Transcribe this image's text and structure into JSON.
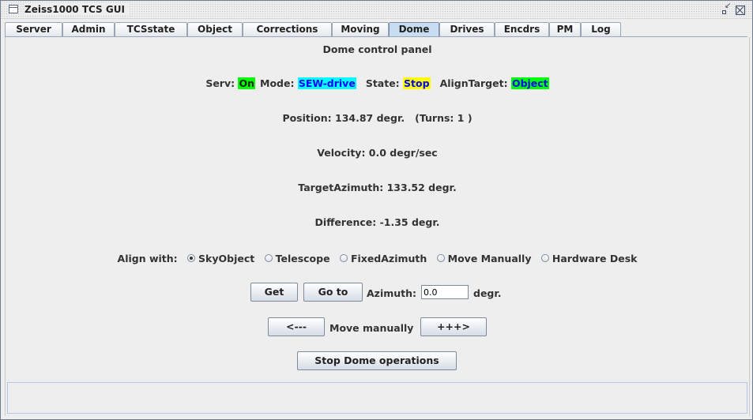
{
  "window": {
    "title": "Zeiss1000 TCS GUI"
  },
  "tabs": [
    "Server",
    "Admin",
    "TCSstate",
    "Object",
    "Corrections",
    "Moving",
    "Dome",
    "Drives",
    "Encdrs",
    "PM",
    "Log"
  ],
  "active_tab": "Dome",
  "panel": {
    "title": "Dome control panel",
    "status": {
      "serv_label": "Serv:",
      "serv_value": "On",
      "mode_label": "Mode:",
      "mode_value": "SEW-drive",
      "state_label": "State:",
      "state_value": "Stop",
      "align_label": "AlignTarget:",
      "align_value": "Object"
    },
    "colors": {
      "on": "#00ff00",
      "mode": "#00ffff",
      "state": "#ffff00",
      "align": "#00ff00",
      "mode_text": "#0000ff",
      "align_text": "#0000ff"
    },
    "position": "Position: 134.87 degr.   (Turns: 1 )",
    "velocity": "Velocity: 0.0 degr/sec",
    "target": "TargetAzimuth: 133.52 degr.",
    "difference": "Difference: -1.35 degr.",
    "align_with": {
      "label": "Align with:",
      "options": [
        "SkyObject",
        "Telescope",
        "FixedAzimuth",
        "Move Manually",
        "Hardware Desk"
      ],
      "selected": "SkyObject"
    },
    "controls": {
      "get": "Get",
      "goto": "Go to",
      "azimuth_label": "Azimuth:",
      "azimuth_value": "0.0",
      "degr": "degr.",
      "left": "<---",
      "move_manually": "Move manually",
      "right": "+++>",
      "stop": "Stop Dome operations"
    }
  }
}
